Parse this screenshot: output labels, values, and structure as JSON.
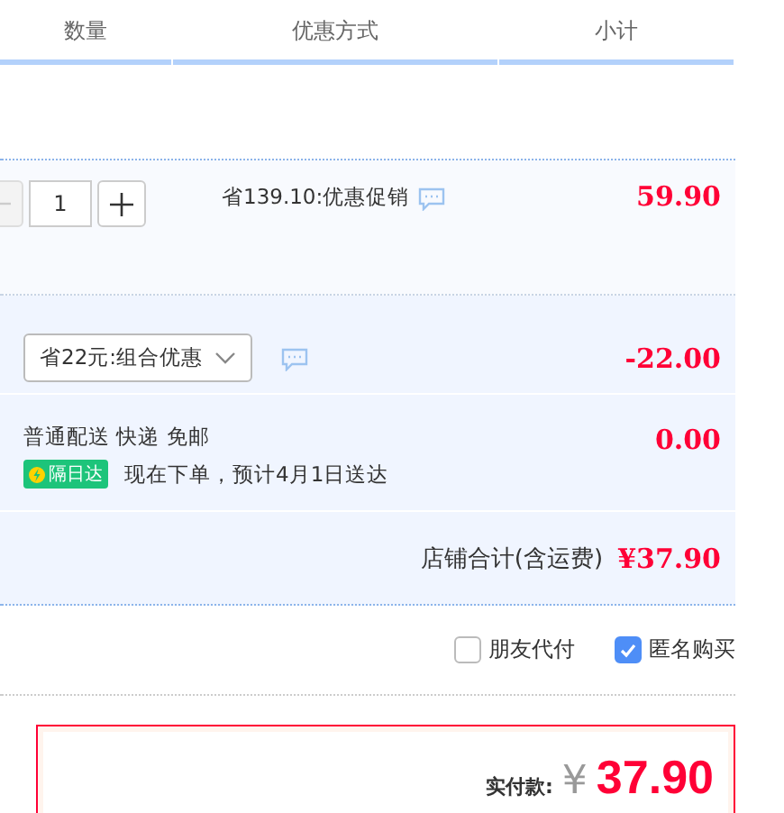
{
  "table": {
    "columns": [
      "数量",
      "优惠方式",
      "小计"
    ]
  },
  "item": {
    "quantity": "1",
    "minus_disabled": true,
    "promotion": "省139.10:优惠促销",
    "subtotal": "59.90"
  },
  "combo": {
    "value": "省22元:组合优惠",
    "amount": "-22.00"
  },
  "shipping": {
    "method": "普通配送 快递 免邮",
    "badge": "隔日达",
    "estimate": "现在下单，预计4月1日送达",
    "amount": "0.00"
  },
  "store_total": {
    "label": "店铺合计(含运费)",
    "amount": "¥37.90"
  },
  "options": [
    {
      "label": "朋友代付",
      "checked": false
    },
    {
      "label": "匿名购买",
      "checked": true
    }
  ],
  "payment": {
    "label": "实付款:",
    "currency": "¥",
    "amount": "37.90"
  }
}
